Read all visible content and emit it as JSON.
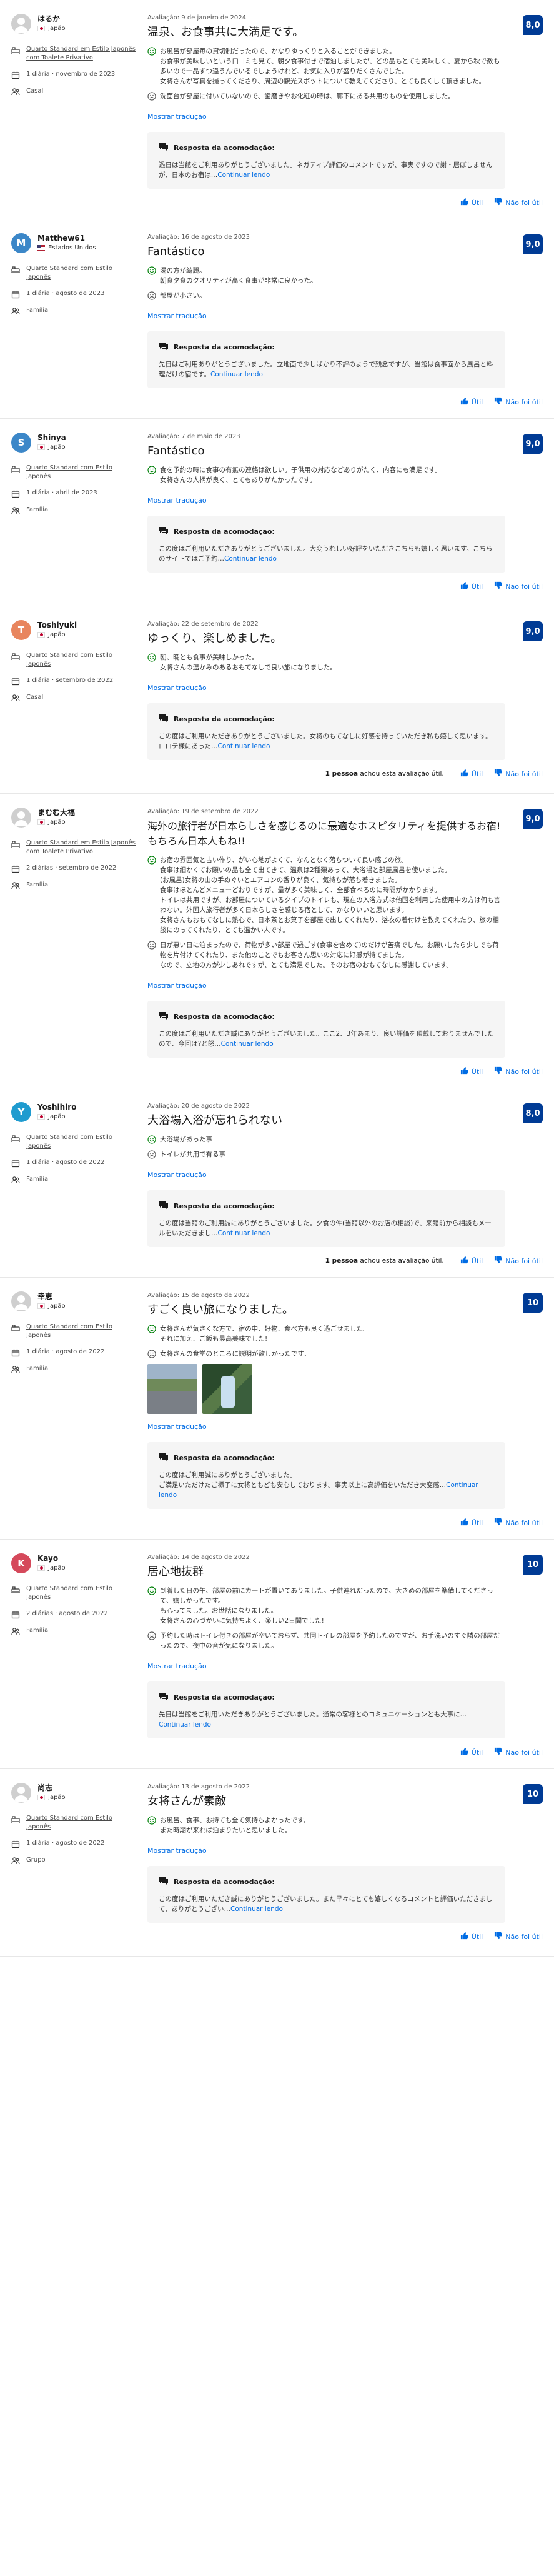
{
  "ui": {
    "show_translation": "Mostrar tradução",
    "response_label": "Resposta da acomodação:",
    "continue_reading": "Continuar lendo",
    "useful": "Útil",
    "not_useful": "Não foi útil"
  },
  "colors": {
    "accent": "#006ce4",
    "score_bg": "#003b95",
    "response_bg": "#f5f5f5"
  },
  "reviews": [
    {
      "name": "はるか",
      "country": "Japão",
      "flag": "jp",
      "avatar": "gray",
      "avatar_letter": "",
      "room": "Quarto Standard em Estilo Japonês com Toalete Privativo",
      "stay": "1 diária · novembro de 2023",
      "group": "Casal",
      "date": "Avaliação: 9 de janeiro de 2024",
      "score": "8,0",
      "title": "温泉、お食事共に大満足です。",
      "positive": "お風呂が部屋毎の貸切制だったので、かなりゆっくりと入ることができました。\nお食事が美味しいという口コミも見て、朝夕食事付きで宿泊しましたが、どの品もとても美味しく、夏から秋で数も多いので一品ずつ違うんでいるでしょうけれど、お気に入りが盛りだくさんでした。\n女将さんが写真を撮ってくださり、周辺の観光スポットについて教えてくださり、とても良くして頂きました。",
      "negative": "洗面台が部屋に付いていないので、歯磨きやお化粧の時は、廊下にある共用のものを使用しました。",
      "response": "過日は当館をご利用ありがとうございました。ネガティブ評価のコメントですが、事実ですので謝・居ぼしませんが、日本のお宿は…",
      "helpful": ""
    },
    {
      "name": "Matthew61",
      "country": "Estados Unidos",
      "flag": "us",
      "avatar": "blue",
      "avatar_letter": "M",
      "room": "Quarto Standard com Estilo Japonês",
      "stay": "1 diária · agosto de 2023",
      "group": "Família",
      "date": "Avaliação: 16 de agosto de 2023",
      "score": "9,0",
      "title": "Fantástico",
      "positive": "湯の方が綺麗。\n朝食夕食のクオリティが高く食事が非常に良かった。",
      "negative": "部屋が小さい。",
      "response": "先日はご利用ありがとうございました。立地面で少しばかり不評のようで残念ですが、当館は食事面から風呂と料理だけの宿です。",
      "helpful": ""
    },
    {
      "name": "Shinya",
      "country": "Japão",
      "flag": "jp",
      "avatar": "blue",
      "avatar_letter": "S",
      "room": "Quarto Standard com Estilo Japonês",
      "stay": "1 diária · abril de 2023",
      "group": "Família",
      "date": "Avaliação: 7 de maio de 2023",
      "score": "9,0",
      "title": "Fantástico",
      "positive": "食を予約の時に食事の有無の連絡は欲しい。子供用の対応などありがたく、内容にも満足です。\n女将さんの人柄が良く、とてもありがたかったです。",
      "negative": "",
      "response": "この度はご利用いただきありがとうございました。大変うれしい好評をいただきこちらも嬉しく思います。こちらのサイトではご予約…",
      "helpful": ""
    },
    {
      "name": "Toshiyuki",
      "country": "Japão",
      "flag": "jp",
      "avatar": "orange",
      "avatar_letter": "T",
      "room": "Quarto Standard com Estilo Japonês",
      "stay": "1 diária · setembro de 2022",
      "group": "Casal",
      "date": "Avaliação: 22 de setembro de 2022",
      "score": "9,0",
      "title": "ゆっくり、楽しめました。",
      "positive": "朝、晩とも食事が美味しかった。\n女将さんの温かみのあるおもてなしで良い旅になりました。",
      "negative": "",
      "response": "この度はご利用いただきありがとうございました。女将のもてなしに好感を持っていただき私も嬉しく思います。ロロテ様にあった…",
      "helpful_count": "1 pessoa",
      "helpful_rest": "achou esta avaliação útil."
    },
    {
      "name": "まむむ大福",
      "country": "Japão",
      "flag": "jp",
      "avatar": "gray",
      "avatar_letter": "",
      "room": "Quarto Standard em Estilo Japonês com Toalete Privativo",
      "stay": "2 diárias · setembro de 2022",
      "group": "Família",
      "date": "Avaliação: 19 de setembro de 2022",
      "score": "9,0",
      "title": "海外の旅行者が日本らしさを感じるのに最適なホスピタリティを提供するお宿!もちろん日本人もね!!",
      "positive": "お宿の雰囲気と古い作り、がい心地がよくて、なんとなく落ちついて良い感じの旅。\n食事は細かくてお願いの品も全て出てきて、温泉は2種類あって、大浴場と部屋風呂を使いました。\n(お風呂)女将の山の手ぬぐいとエアコンの香りが良く、気持ちが落ち着きました。\n食事はほとんどメニューどおりですが、量が多く美味しく、全部食べるのに時間がかかります。\nトイレは共用ですが、お部屋についているタイプのトイレも、現在の入浴方式は他国を利用した使用中の方は何も言わない。外国人旅行者が多く日本らしさを感じる宿として、かなりいいと思います。\n女将さんもおもてなしに熱心で、日本茶とお菓子を部屋で出してくれたり、浴衣の着付けを教えてくれたり、旅の相談にのってくれたり、とても温かい人です。",
      "negative": "日が悪い日に泊まったので、荷物が多い部屋で過ごす(食事を含めて)のだけが苦痛でした。お願いしたら少しでも荷物を片付けてくれたり、また他のことでもお客さん思いの対応に好感が持てました。\nなので、立地の方が少しあれですが、とても満足でした。そのお宿のおもてなしに感謝しています。",
      "response": "この度はご利用いただき誠にありがとうございました。ここ2、3年あまり、良い評価を頂戴しておりませんでしたので、今回は?と怒…",
      "helpful": ""
    },
    {
      "name": "Yoshihiro",
      "country": "Japão",
      "flag": "jp",
      "avatar": "teal",
      "avatar_letter": "Y",
      "room": "Quarto Standard com Estilo Japonês",
      "stay": "1 diária · agosto de 2022",
      "group": "Família",
      "date": "Avaliação: 20 de agosto de 2022",
      "score": "8,0",
      "title": "大浴場入浴が忘れられない",
      "positive": "大浴場があった事",
      "negative": "トイレが共用で有る事",
      "response": "この度は当館のご利用誠にありがとうございました。夕食の件(当館以外のお店の相談)で、来館前から相談もメールをいただきまし…",
      "helpful_count": "1 pessoa",
      "helpful_rest": "achou esta avaliação útil."
    },
    {
      "name": "幸恵",
      "country": "Japão",
      "flag": "jp",
      "avatar": "gray",
      "avatar_letter": "",
      "room": "Quarto Standard com Estilo Japonês",
      "stay": "1 diária · agosto de 2022",
      "group": "Família",
      "date": "Avaliação: 15 de agosto de 2022",
      "score": "10",
      "title": "すごく良い旅になりました。",
      "positive": "女将さんが気さくな方で、宿の中、好物、食べ方も良く過ごせました。\nそれに加え、ご飯も最高美味でした!",
      "negative": "女将さんの食堂のところに説明が欲しかったです。",
      "response": "この度はご利用誠にありがとうございました。\nご満足いただけたご様子に女将ともども安心しております。事実以上に高評価をいただき大変感…",
      "helpful": ""
    },
    {
      "name": "Kayo",
      "country": "Japão",
      "flag": "jp",
      "avatar": "red",
      "avatar_letter": "K",
      "room": "Quarto Standard com Estilo Japonês",
      "stay": "2 diárias · agosto de 2022",
      "group": "Família",
      "date": "Avaliação: 14 de agosto de 2022",
      "score": "10",
      "title": "居心地抜群",
      "positive": "到着した日の午、部屋の前にカートが置いてありました。子供連れだったので、大きめの部屋を準備してくださって、嬉しかったです。\nも心ってました。お世話になりました。\n女将さんの心づかいに気持ちよく、楽しい2日間でした!",
      "negative": "予約した時はトイレ付きの部屋が空いておらず、共同トイレの部屋を予約したのですが、お手洗いのすぐ隣の部屋だったので、夜中の音が気になりました。",
      "response": "先日は当館をご利用いただきありがとうございました。通常の客様とのコミュニケーションとも大事に…",
      "helpful": ""
    },
    {
      "name": "尚志",
      "country": "Japão",
      "flag": "jp",
      "avatar": "gray",
      "avatar_letter": "",
      "room": "Quarto Standard com Estilo Japonês",
      "stay": "1 diária · agosto de 2022",
      "group": "Grupo",
      "date": "Avaliação: 13 de agosto de 2022",
      "score": "10",
      "title": "女将さんが素敵",
      "positive": "お風呂、食事、お持ても全て気持ちよかったです。\nまた時期が来れば泊まりたいと思いました。",
      "negative": "",
      "response": "この度はご利用いただき誠にありがとうございました。また早々にとても嬉しくなるコメントと評価いただきまして、ありがとうござい…",
      "helpful": ""
    }
  ]
}
